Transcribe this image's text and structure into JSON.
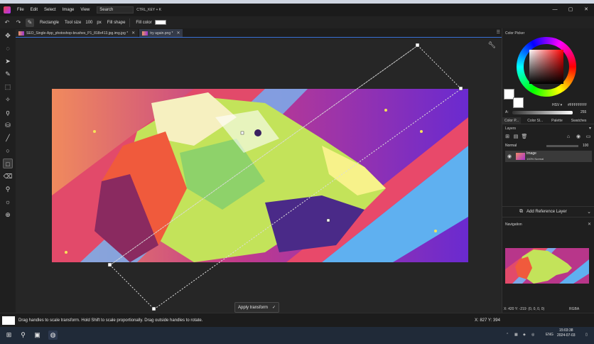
{
  "menu": {
    "items": [
      "File",
      "Edit",
      "Select",
      "Image",
      "View"
    ],
    "search_label": "Search",
    "search_shortcut": "CTRL_KEY + K"
  },
  "window_controls": [
    "—",
    "▢",
    "✕"
  ],
  "toolbar": {
    "shape_label": "Rectangle",
    "tool_size_label": "Tool size",
    "tool_size_value": "100",
    "tool_size_unit": "px",
    "fill_shape_label": "Fill shape",
    "fill_color_label": "Fill color",
    "fill_color": "#ffffff"
  },
  "tabs": [
    {
      "label": "SEO_Single-App_photoshop-brushes_P1_818x413.jpg.img.jpg *",
      "active": false
    },
    {
      "label": "try again.png *",
      "active": true
    }
  ],
  "canvas": {
    "apply_label": "Apply transform",
    "apply_icon": "✓"
  },
  "color_picker": {
    "title": "Color Picker",
    "mode": "HSV ▾",
    "hex": "#FFFFFFFF",
    "alpha_label": "A:",
    "alpha_value": "255",
    "tabs": [
      "Color P...",
      "Color Sl...",
      "Palette",
      "Swatches"
    ]
  },
  "layers": {
    "title": "Layers",
    "blend_mode": "Normal",
    "opacity": "100",
    "items": [
      {
        "name": "Image",
        "detail": "100%  Normal"
      }
    ],
    "add_reference_label": "Add Reference Layer"
  },
  "navigation": {
    "title": "Navigation",
    "coords": "X: 420 Y: -219",
    "pixel": "(0, 0, 0, 0)",
    "color_mode": "RGBA"
  },
  "status": {
    "message": "Drag handles to scale transform. Hold Shift to scale proportionally. Drag outside handles to rotate.",
    "cursor": "X: 827 Y: 394"
  },
  "taskbar": {
    "language": "ENG",
    "time": "15:03:38",
    "date": "2024-07-03"
  }
}
